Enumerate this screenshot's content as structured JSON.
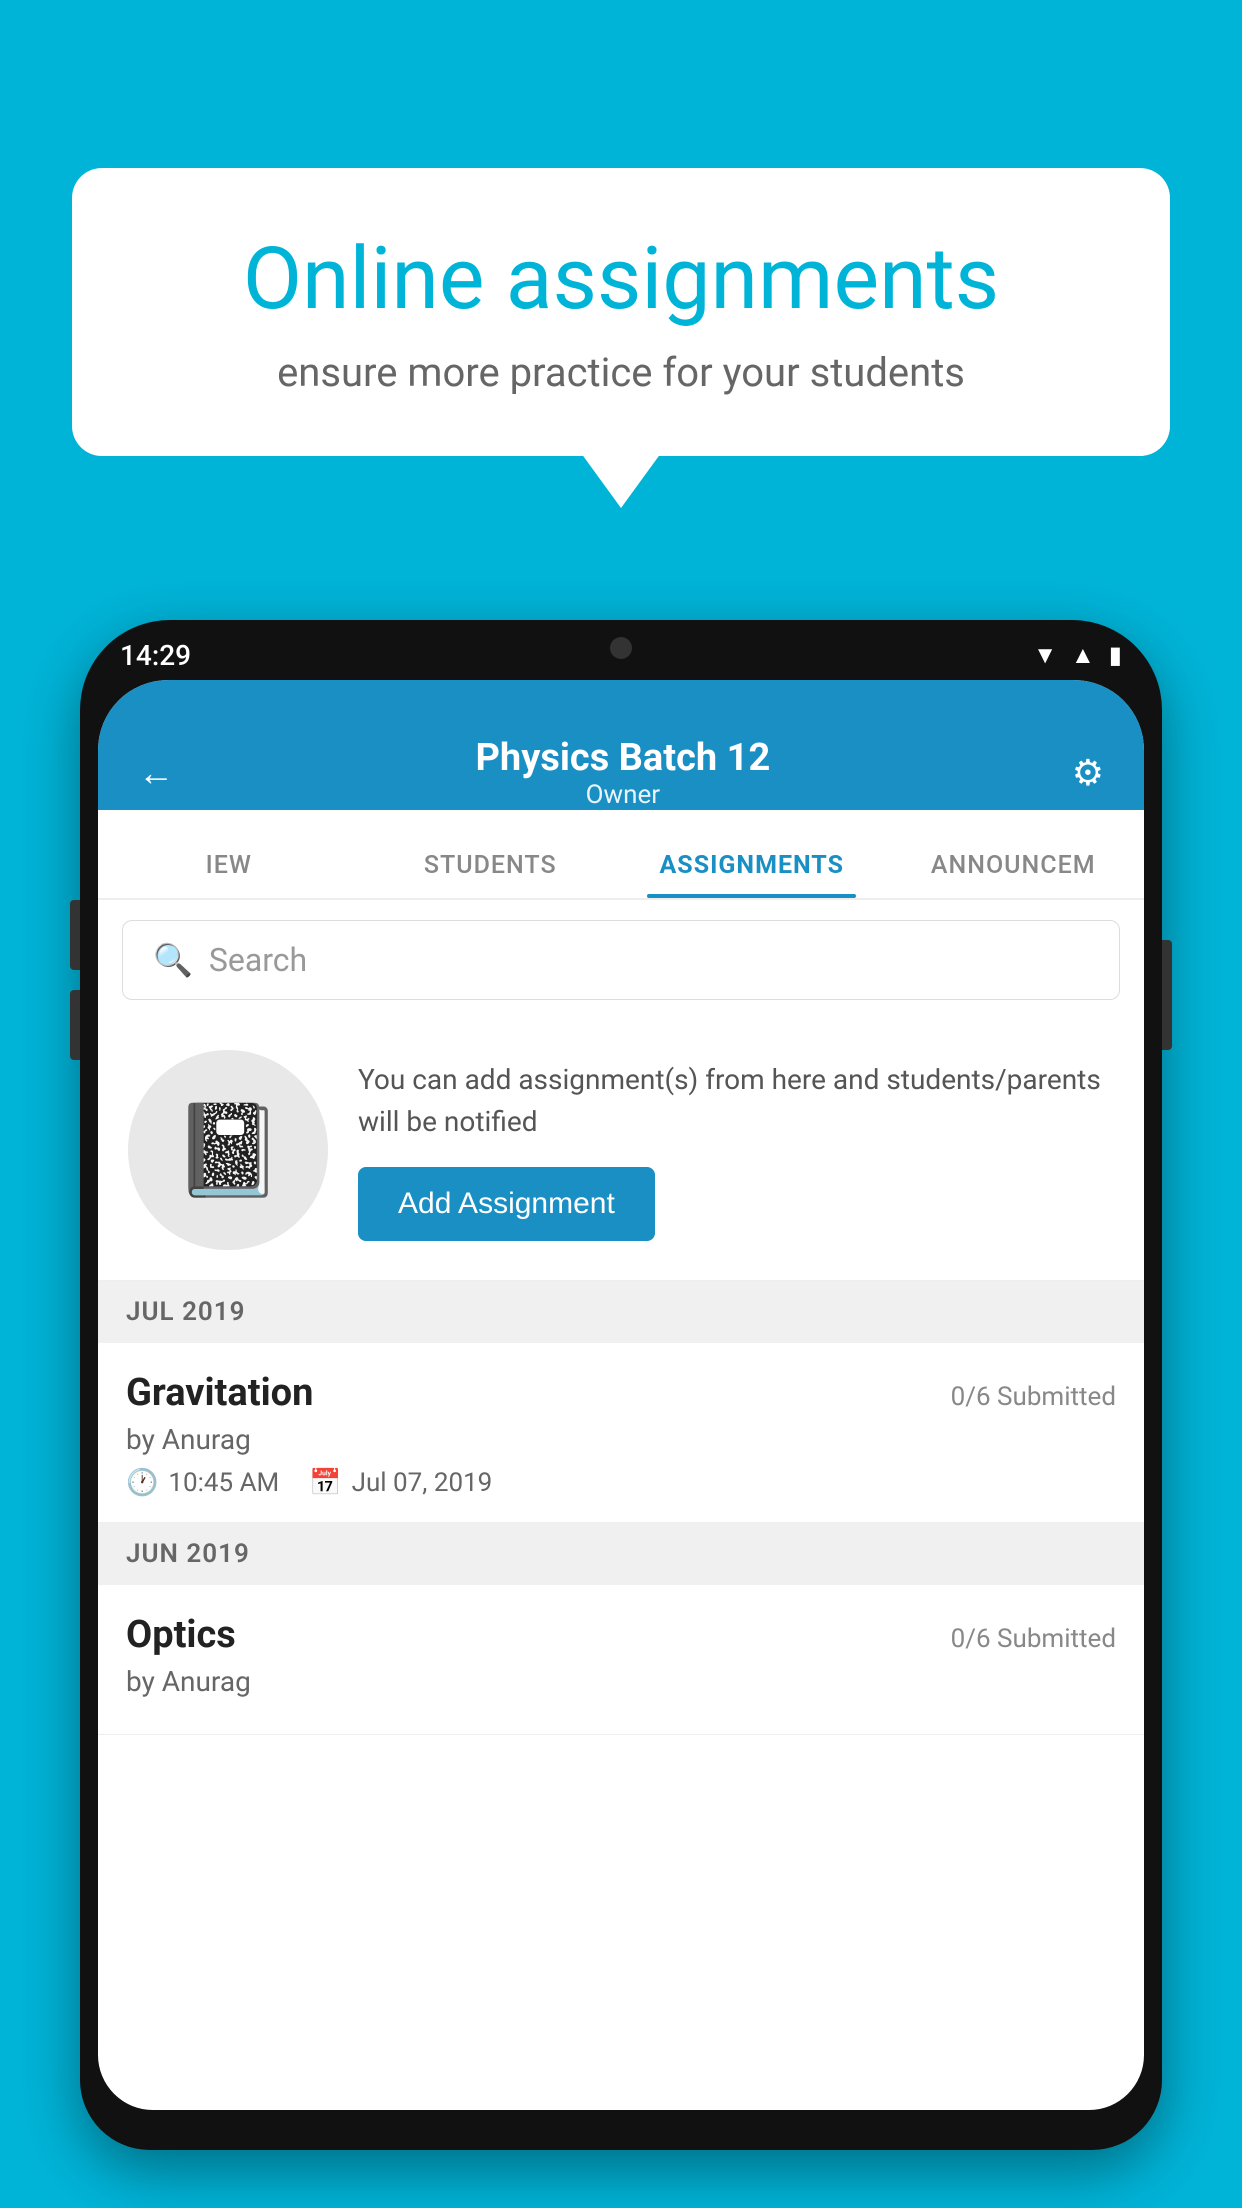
{
  "bubble": {
    "title": "Online assignments",
    "subtitle": "ensure more practice for your students"
  },
  "phone": {
    "status_time": "14:29",
    "header": {
      "title": "Physics Batch 12",
      "subtitle": "Owner"
    },
    "tabs": [
      {
        "label": "IEW",
        "active": false
      },
      {
        "label": "STUDENTS",
        "active": false
      },
      {
        "label": "ASSIGNMENTS",
        "active": true
      },
      {
        "label": "ANNOUNCEM",
        "active": false
      }
    ],
    "search": {
      "placeholder": "Search"
    },
    "info_card": {
      "description": "You can add assignment(s) from here and students/parents will be notified",
      "button_label": "Add Assignment"
    },
    "sections": [
      {
        "header": "JUL 2019",
        "items": [
          {
            "name": "Gravitation",
            "submitted": "0/6 Submitted",
            "author": "by Anurag",
            "time": "10:45 AM",
            "date": "Jul 07, 2019"
          }
        ]
      },
      {
        "header": "JUN 2019",
        "items": [
          {
            "name": "Optics",
            "submitted": "0/6 Submitted",
            "author": "by Anurag",
            "time": "",
            "date": ""
          }
        ]
      }
    ]
  },
  "colors": {
    "brand_blue": "#1a8fc4",
    "background_cyan": "#00b4d8"
  }
}
